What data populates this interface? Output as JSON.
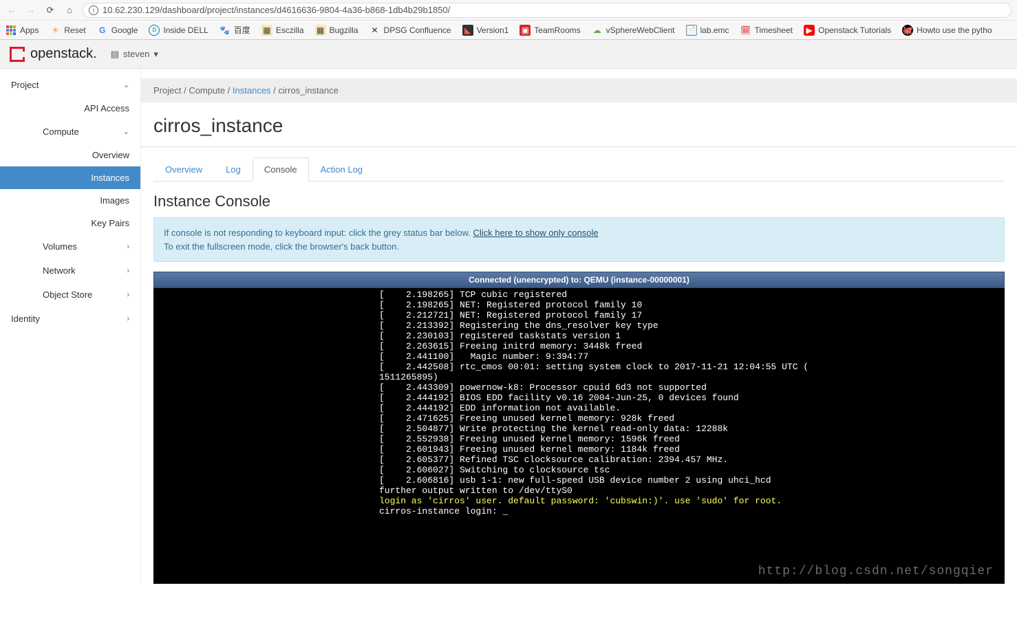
{
  "browser": {
    "url": "10.62.230.129/dashboard/project/instances/d4616636-9804-4a36-b868-1db4b29b1850/",
    "bookmarks": [
      {
        "label": "Apps"
      },
      {
        "label": "Reset"
      },
      {
        "label": "Google"
      },
      {
        "label": "Inside DELL"
      },
      {
        "label": "百度"
      },
      {
        "label": "Esczilla"
      },
      {
        "label": "Bugzilla"
      },
      {
        "label": "DPSG Confluence"
      },
      {
        "label": "Version1"
      },
      {
        "label": "TeamRooms"
      },
      {
        "label": "vSphereWebClient"
      },
      {
        "label": "lab.emc"
      },
      {
        "label": "Timesheet"
      },
      {
        "label": "Openstack Tutorials"
      },
      {
        "label": "Howto use the pytho"
      }
    ]
  },
  "header": {
    "brand": "openstack.",
    "user": "steven"
  },
  "sidebar": {
    "project_label": "Project",
    "api_access": "API Access",
    "compute_label": "Compute",
    "compute_items": [
      "Overview",
      "Instances",
      "Images",
      "Key Pairs"
    ],
    "volumes": "Volumes",
    "network": "Network",
    "object_store": "Object Store",
    "identity": "Identity"
  },
  "breadcrumb": {
    "p1": "Project",
    "p2": "Compute",
    "p3": "Instances",
    "p4": "cirros_instance"
  },
  "page_title": "cirros_instance",
  "tabs": [
    "Overview",
    "Log",
    "Console",
    "Action Log"
  ],
  "section_title": "Instance Console",
  "info": {
    "line1a": "If console is not responding to keyboard input: click the grey status bar below. ",
    "line1_link": "Click here to show only console",
    "line2": "To exit the fullscreen mode, click the browser's back button."
  },
  "console_status": "Connected (unencrypted) to: QEMU (instance-00000001)",
  "console_lines": [
    "[    2.198265] TCP cubic registered",
    "[    2.198265] NET: Registered protocol family 10",
    "[    2.212721] NET: Registered protocol family 17",
    "[    2.213392] Registering the dns_resolver key type",
    "[    2.230103] registered taskstats version 1",
    "[    2.263615] Freeing initrd memory: 3448k freed",
    "[    2.441100]   Magic number: 9:394:77",
    "[    2.442508] rtc_cmos 00:01: setting system clock to 2017-11-21 12:04:55 UTC (",
    "1511265895)",
    "[    2.443309] powernow-k8: Processor cpuid 6d3 not supported",
    "[    2.444192] BIOS EDD facility v0.16 2004-Jun-25, 0 devices found",
    "[    2.444192] EDD information not available.",
    "[    2.471625] Freeing unused kernel memory: 928k freed",
    "[    2.504877] Write protecting the kernel read-only data: 12288k",
    "[    2.552938] Freeing unused kernel memory: 1596k freed",
    "[    2.601943] Freeing unused kernel memory: 1184k freed",
    "[    2.605377] Refined TSC clocksource calibration: 2394.457 MHz.",
    "[    2.606027] Switching to clocksource tsc",
    "[    2.606816] usb 1-1: new full-speed USB device number 2 using uhci_hcd",
    "",
    "further output written to /dev/ttyS0",
    "",
    ""
  ],
  "console_login_hint": "login as 'cirros' user. default password: 'cubswin:)'. use 'sudo' for root.",
  "console_prompt": "cirros-instance login: _",
  "watermark": "http://blog.csdn.net/songqier"
}
